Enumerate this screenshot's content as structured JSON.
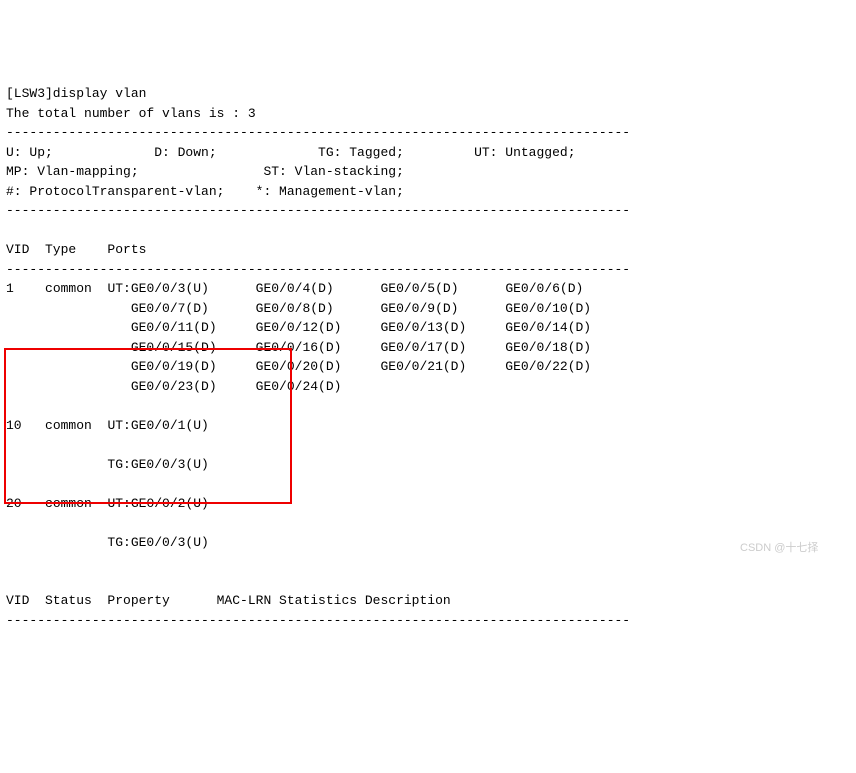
{
  "header": {
    "prompt": "[LSW3]display vlan",
    "total_line": "The total number of vlans is : 3"
  },
  "legend": {
    "row1": "U: Up;             D: Down;             TG: Tagged;         UT: Untagged;",
    "row2": "MP: Vlan-mapping;                ST: Vlan-stacking;",
    "row3": "#: ProtocolTransparent-vlan;    *: Management-vlan;"
  },
  "divider": "--------------------------------------------------------------------------------",
  "columns_header": "VID  Type    Ports",
  "vlan1": {
    "vid": "1",
    "type": "common",
    "row1": "UT:GE0/0/3(U)      GE0/0/4(D)      GE0/0/5(D)      GE0/0/6(D)",
    "row2": "   GE0/0/7(D)      GE0/0/8(D)      GE0/0/9(D)      GE0/0/10(D)",
    "row3": "   GE0/0/11(D)     GE0/0/12(D)     GE0/0/13(D)     GE0/0/14(D)",
    "row4": "   GE0/0/15(D)     GE0/0/16(D)     GE0/0/17(D)     GE0/0/18(D)",
    "row5": "   GE0/0/19(D)     GE0/0/20(D)     GE0/0/21(D)     GE0/0/22(D)",
    "row6": "   GE0/0/23(D)     GE0/0/24(D)"
  },
  "vlan10": {
    "vid": "10",
    "type": "common",
    "ut": "UT:GE0/0/1(U)",
    "tg": "TG:GE0/0/3(U)"
  },
  "vlan20": {
    "vid": "20",
    "type": "common",
    "ut": "UT:GE0/0/2(U)",
    "tg": "TG:GE0/0/3(U)"
  },
  "footer_header": "VID  Status  Property      MAC-LRN Statistics Description",
  "watermark": "CSDN @十七择"
}
